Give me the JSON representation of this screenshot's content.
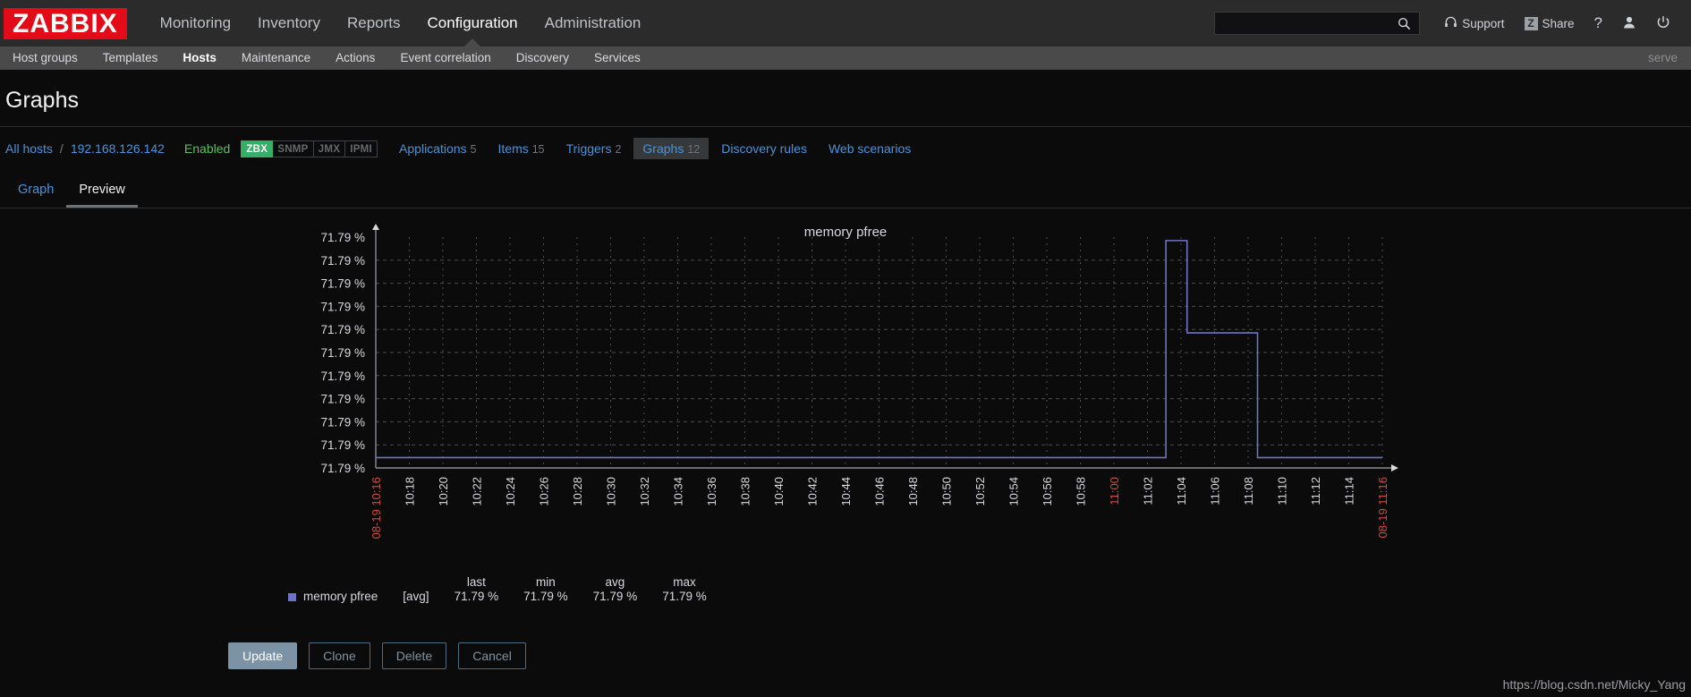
{
  "header": {
    "logo": "ZABBIX",
    "nav": [
      {
        "label": "Monitoring",
        "selected": false
      },
      {
        "label": "Inventory",
        "selected": false
      },
      {
        "label": "Reports",
        "selected": false
      },
      {
        "label": "Configuration",
        "selected": true
      },
      {
        "label": "Administration",
        "selected": false
      }
    ],
    "search": {
      "value": "",
      "placeholder": ""
    },
    "support_label": "Support",
    "share_label": "Share",
    "share_badge": "Z",
    "help_label": "?",
    "icons": [
      "search-icon",
      "headset-icon",
      "z-share-icon",
      "question-icon",
      "user-icon",
      "power-icon"
    ]
  },
  "subnav": {
    "items": [
      {
        "label": "Host groups",
        "selected": false
      },
      {
        "label": "Templates",
        "selected": false
      },
      {
        "label": "Hosts",
        "selected": true
      },
      {
        "label": "Maintenance",
        "selected": false
      },
      {
        "label": "Actions",
        "selected": false
      },
      {
        "label": "Event correlation",
        "selected": false
      },
      {
        "label": "Discovery",
        "selected": false
      },
      {
        "label": "Services",
        "selected": false
      }
    ],
    "server_label": "serve"
  },
  "page": {
    "title": "Graphs"
  },
  "breadcrumb": {
    "all_hosts": "All hosts",
    "separator": "/",
    "host": "192.168.126.142",
    "status": "Enabled",
    "interfaces": [
      {
        "label": "ZBX",
        "active": true
      },
      {
        "label": "SNMP",
        "active": false
      },
      {
        "label": "JMX",
        "active": false
      },
      {
        "label": "IPMI",
        "active": false
      }
    ],
    "tabs": [
      {
        "label": "Applications",
        "count": "5",
        "selected": false
      },
      {
        "label": "Items",
        "count": "15",
        "selected": false
      },
      {
        "label": "Triggers",
        "count": "2",
        "selected": false
      },
      {
        "label": "Graphs",
        "count": "12",
        "selected": true
      },
      {
        "label": "Discovery rules",
        "count": "",
        "selected": false
      },
      {
        "label": "Web scenarios",
        "count": "",
        "selected": false
      }
    ]
  },
  "tabstrip": {
    "tabs": [
      {
        "label": "Graph",
        "selected": false
      },
      {
        "label": "Preview",
        "selected": true
      }
    ]
  },
  "chart_data": {
    "type": "line",
    "title": "memory pfree",
    "xlabel": "",
    "ylabel": "",
    "grid": true,
    "legend_position": "bottom-left",
    "yticks": [
      "71.79 %",
      "71.79 %",
      "71.79 %",
      "71.79 %",
      "71.79 %",
      "71.79 %",
      "71.79 %",
      "71.79 %",
      "71.79 %",
      "71.79 %",
      "71.79 %"
    ],
    "xticks": [
      {
        "label": "08-19 10:16",
        "highlight": true
      },
      {
        "label": "10:18",
        "highlight": false
      },
      {
        "label": "10:20",
        "highlight": false
      },
      {
        "label": "10:22",
        "highlight": false
      },
      {
        "label": "10:24",
        "highlight": false
      },
      {
        "label": "10:26",
        "highlight": false
      },
      {
        "label": "10:28",
        "highlight": false
      },
      {
        "label": "10:30",
        "highlight": false
      },
      {
        "label": "10:32",
        "highlight": false
      },
      {
        "label": "10:34",
        "highlight": false
      },
      {
        "label": "10:36",
        "highlight": false
      },
      {
        "label": "10:38",
        "highlight": false
      },
      {
        "label": "10:40",
        "highlight": false
      },
      {
        "label": "10:42",
        "highlight": false
      },
      {
        "label": "10:44",
        "highlight": false
      },
      {
        "label": "10:46",
        "highlight": false
      },
      {
        "label": "10:48",
        "highlight": false
      },
      {
        "label": "10:50",
        "highlight": false
      },
      {
        "label": "10:52",
        "highlight": false
      },
      {
        "label": "10:54",
        "highlight": false
      },
      {
        "label": "10:56",
        "highlight": false
      },
      {
        "label": "10:58",
        "highlight": false
      },
      {
        "label": "11:00",
        "highlight": true
      },
      {
        "label": "11:02",
        "highlight": false
      },
      {
        "label": "11:04",
        "highlight": false
      },
      {
        "label": "11:06",
        "highlight": false
      },
      {
        "label": "11:08",
        "highlight": false
      },
      {
        "label": "11:10",
        "highlight": false
      },
      {
        "label": "11:12",
        "highlight": false
      },
      {
        "label": "11:14",
        "highlight": false
      },
      {
        "label": "08-19 11:16",
        "highlight": true
      }
    ],
    "series": [
      {
        "name": "memory pfree",
        "color": "#6c74c4",
        "function": "[avg]",
        "points": [
          {
            "x": 0.0,
            "y": 0.045
          },
          {
            "x": 0.785,
            "y": 0.045
          },
          {
            "x": 0.785,
            "y": 0.985
          },
          {
            "x": 0.806,
            "y": 0.985
          },
          {
            "x": 0.806,
            "y": 0.585
          },
          {
            "x": 0.876,
            "y": 0.585
          },
          {
            "x": 0.876,
            "y": 0.045
          },
          {
            "x": 1.0,
            "y": 0.045
          }
        ]
      }
    ],
    "stats_headers": [
      "last",
      "min",
      "avg",
      "max"
    ],
    "stats_values": [
      "71.79 %",
      "71.79 %",
      "71.79 %",
      "71.79 %"
    ]
  },
  "buttons": [
    {
      "label": "Update",
      "primary": true
    },
    {
      "label": "Clone",
      "primary": false
    },
    {
      "label": "Delete",
      "primary": false
    },
    {
      "label": "Cancel",
      "primary": false
    }
  ],
  "watermark": "https://blog.csdn.net/Micky_Yang"
}
